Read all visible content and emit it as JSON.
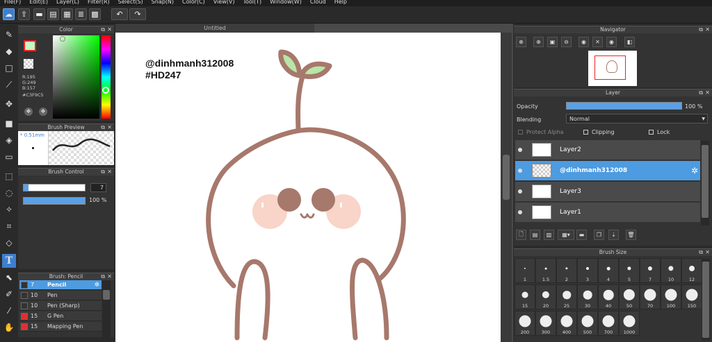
{
  "menu": [
    "File(F)",
    "Edit(E)",
    "Layer(L)",
    "Filter(R)",
    "Select(S)",
    "Snap(N)",
    "Color(C)",
    "View(V)",
    "Tool(T)",
    "Window(W)",
    "Cloud",
    "Help"
  ],
  "canvas": {
    "tab_title": "Untitled",
    "watermark_line1": "@dinhmanh312008",
    "watermark_line2": "#HD247"
  },
  "color_panel": {
    "title": "Color",
    "r_label": "R:195",
    "g_label": "G:249",
    "b_label": "B:157",
    "hex": "#C3F9C5",
    "primary_color": "#c3f9c5",
    "secondary_color": "#e8dcc8"
  },
  "brush_preview": {
    "title": "Brush Preview",
    "size": "0.51mm"
  },
  "brush_control": {
    "title": "Brush Control",
    "size_value": "7",
    "opacity_value": "100 %",
    "size_fraction": 0.08,
    "opacity_fraction": 1.0
  },
  "brush_list": {
    "title": "Brush: Pencil",
    "items": [
      {
        "size": "7",
        "name": "Pencil",
        "color": "#333333",
        "selected": true
      },
      {
        "size": "10",
        "name": "Pen",
        "color": "#333333",
        "selected": false
      },
      {
        "size": "10",
        "name": "Pen (Sharp)",
        "color": "#333333",
        "selected": false
      },
      {
        "size": "15",
        "name": "G Pen",
        "color": "#e03030",
        "selected": false
      },
      {
        "size": "15",
        "name": "Mapping Pen",
        "color": "#e03030",
        "selected": false
      }
    ]
  },
  "navigator": {
    "title": "Navigator"
  },
  "layer_panel": {
    "title": "Layer",
    "opacity_label": "Opacity",
    "opacity_value": "100 %",
    "opacity_fraction": 1.0,
    "blending_label": "Blending",
    "blending_value": "Normal",
    "protect_alpha": "Protect Alpha",
    "clipping": "Clipping",
    "lock": "Lock",
    "layers": [
      {
        "name": "Layer2",
        "selected": false
      },
      {
        "name": "@dinhmanh312008",
        "selected": true
      },
      {
        "name": "Layer3",
        "selected": false
      },
      {
        "name": "Layer1",
        "selected": false
      }
    ]
  },
  "brush_size": {
    "title": "Brush Size",
    "sizes": [
      "1",
      "1.5",
      "2",
      "3",
      "4",
      "5",
      "7",
      "10",
      "12",
      "15",
      "20",
      "25",
      "30",
      "40",
      "50",
      "70",
      "100",
      "150",
      "200",
      "300",
      "400",
      "500",
      "700",
      "1000"
    ]
  },
  "colors": {
    "accent": "#4d9be0",
    "character_stroke": "#a7786c",
    "leaf": "#b8e5a8",
    "cheek": "#f9d4c8",
    "eye": "#a7786c"
  }
}
